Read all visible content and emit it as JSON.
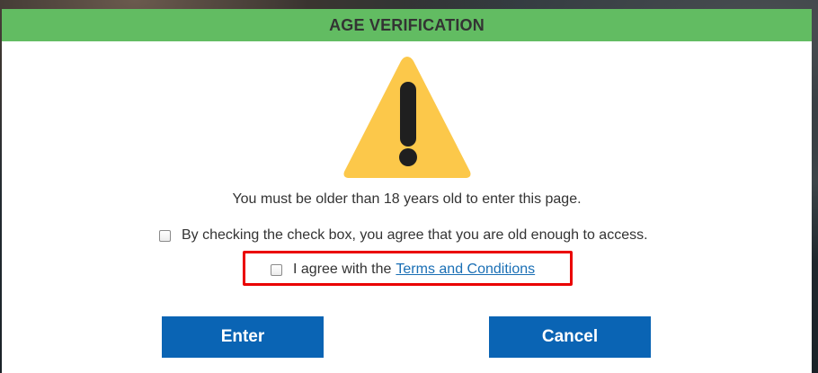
{
  "modal": {
    "title": "AGE VERIFICATION",
    "icon": "warning-triangle-icon",
    "message": "You must be older than 18 years old to enter this page.",
    "checkbox_age": {
      "label": "By checking the check box, you agree that you are old enough to access.",
      "checked": false
    },
    "checkbox_terms": {
      "label_prefix": "I agree with the",
      "link_text": "Terms and Conditions",
      "checked": false
    },
    "buttons": {
      "enter": "Enter",
      "cancel": "Cancel"
    }
  },
  "colors": {
    "header": "#62bc62",
    "button": "#0a64b4",
    "warning": "#fcc84a",
    "link": "#1a6fb5",
    "highlight": "#ea0000"
  }
}
